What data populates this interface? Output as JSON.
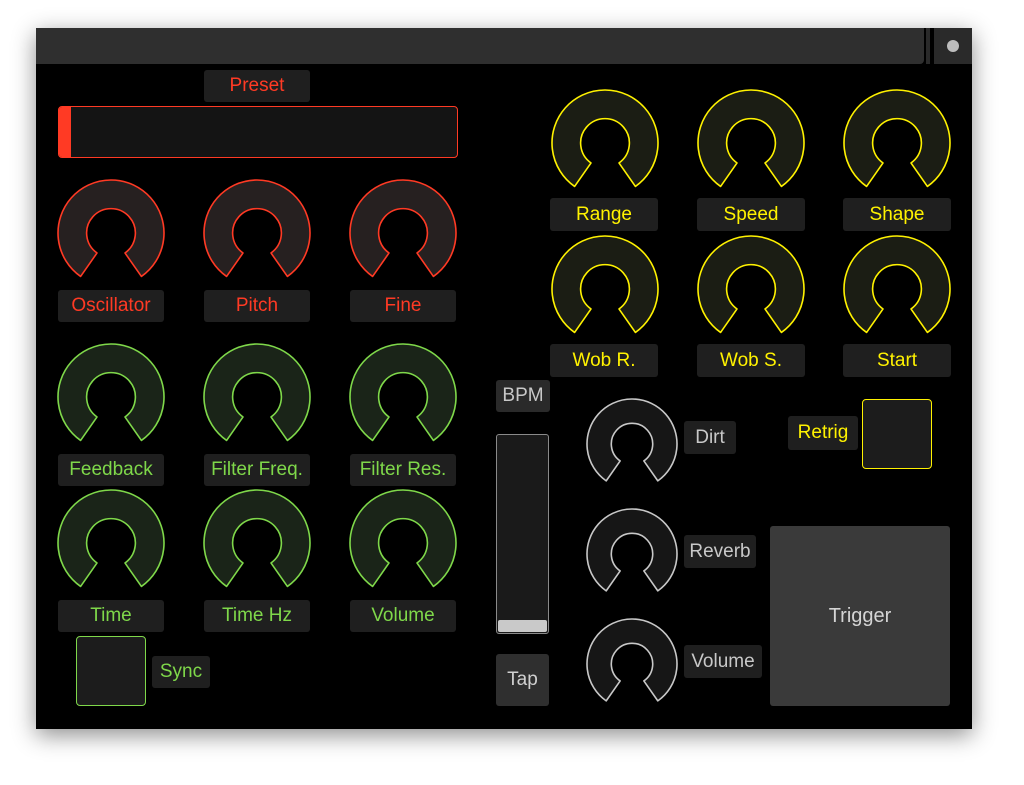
{
  "colors": {
    "red": "#ff3a24",
    "yellow": "#fff200",
    "green": "#7fd84a",
    "gray": "#c8c8c8"
  },
  "preset": {
    "label": "Preset",
    "fill_fraction": 0.03
  },
  "osc_knobs": [
    {
      "label": "Oscillator",
      "value": 0.5
    },
    {
      "label": "Pitch",
      "value": 0.5
    },
    {
      "label": "Fine",
      "value": 0.5
    }
  ],
  "fx_knobs": [
    {
      "label": "Feedback",
      "value": 0.5
    },
    {
      "label": "Filter Freq.",
      "value": 0.5
    },
    {
      "label": "Filter Res.",
      "value": 0.5
    },
    {
      "label": "Time",
      "value": 0.5
    },
    {
      "label": "Time Hz",
      "value": 0.5
    },
    {
      "label": "Volume",
      "value": 0.5
    }
  ],
  "sync": {
    "label": "Sync",
    "on": false
  },
  "wobble_knobs": [
    {
      "label": "Range",
      "value": 0.5
    },
    {
      "label": "Speed",
      "value": 0.5
    },
    {
      "label": "Shape",
      "value": 0.5
    },
    {
      "label": "Wob R.",
      "value": 0.5
    },
    {
      "label": "Wob S.",
      "value": 0.5
    },
    {
      "label": "Start",
      "value": 0.5
    }
  ],
  "bpm": {
    "label": "BPM",
    "tap_label": "Tap",
    "slider_fraction": 0.0
  },
  "mix_knobs": [
    {
      "label": "Dirt",
      "value": 0.5
    },
    {
      "label": "Reverb",
      "value": 0.5
    },
    {
      "label": "Volume",
      "value": 0.5
    }
  ],
  "retrig": {
    "label": "Retrig",
    "on": false
  },
  "trigger": {
    "label": "Trigger"
  }
}
